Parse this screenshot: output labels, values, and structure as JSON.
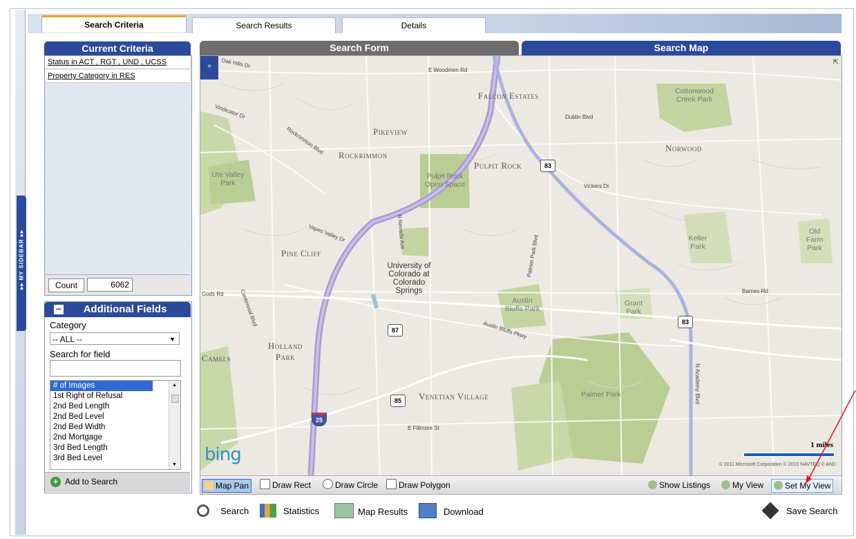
{
  "tabs": [
    {
      "label": "Search Criteria",
      "active": true
    },
    {
      "label": "Search Results",
      "active": false
    },
    {
      "label": "Details",
      "active": false
    }
  ],
  "sidebar": {
    "label": "▸▸ MY SIDEBAR ▸▸"
  },
  "criteria": {
    "title": "Current Criteria",
    "items": [
      "Status in ACT , RGT , UND , UCSS",
      "Property Category in RES"
    ],
    "count_label": "Count",
    "count_value": "6062"
  },
  "additional": {
    "title": "Additional Fields",
    "collapse_symbol": "−",
    "category_label": "Category",
    "category_value": "-- ALL --",
    "search_label": "Search for field",
    "fields": [
      "# of Images",
      "1st Right of Refusal",
      "2nd Bed Length",
      "2nd Bed Level",
      "2nd Bed Width",
      "2nd Mortgage",
      "3rd Bed Length",
      "3rd Bed Level"
    ],
    "add_label": "Add to Search"
  },
  "panels": {
    "form": "Search Form",
    "map": "Search Map"
  },
  "map": {
    "areas": [
      "Falcon Estates",
      "Pikeview",
      "Rockrimmon",
      "Pulpit Rock",
      "Norwood",
      "Pine Cliff",
      "Holland Park",
      "Venetian Village",
      "Camels"
    ],
    "parks": [
      "Cottonwood Creek Park",
      "Ute Valley Park",
      "Pulpit Rock Open Space",
      "Keller Park",
      "Old Farm Park",
      "Austin Bluffs Park",
      "Grant Park",
      "Palmer Park",
      "University of Colorado at Colorado Springs"
    ],
    "streets": [
      "Oak Hills Dr",
      "E Woodmen Rd",
      "Dublin Blvd",
      "Vindicator Dr",
      "Rockrimmon Blvd",
      "Vickers Dr",
      "Vapes Valley Dr",
      "Gods Rd",
      "Austin Bluffs Pkwy",
      "E Fillmore St",
      "Barnes Rd",
      "Centennial Blvd",
      "N Nevada Ave",
      "N Academy Blvd",
      "Palmer Park Blvd"
    ],
    "shields": [
      "83",
      "83",
      "87",
      "85",
      "25"
    ],
    "brand": "bing",
    "scale": "1 miles",
    "copyright": "© 2011 Microsoft Corporation   © 2010 NAVTEQ © AND"
  },
  "toolbar": {
    "map_pan": "Map Pan",
    "draw_rect": "Draw Rect",
    "draw_circle": "Draw Circle",
    "draw_polygon": "Draw Polygon",
    "show_listings": "Show Listings",
    "my_view": "My View",
    "set_my_view": "Set My View"
  },
  "actions": {
    "search": "Search",
    "statistics": "Statistics",
    "map_results": "Map Results",
    "download": "Download",
    "save_search": "Save Search"
  },
  "colors": {
    "brand_blue": "#2b4a9b",
    "accent_orange": "#f0a320",
    "annotation_red": "#e8141c"
  }
}
